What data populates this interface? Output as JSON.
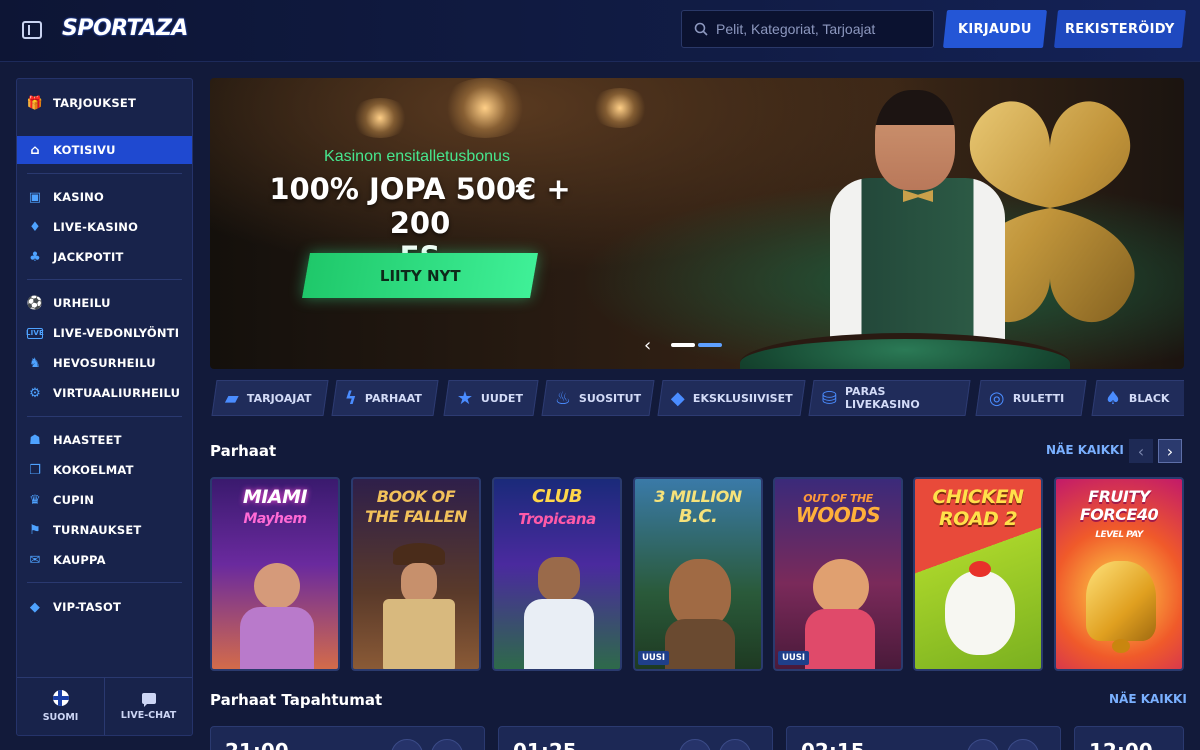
{
  "header": {
    "logo_text": "SPORTAZA",
    "search_placeholder": "Pelit, Kategoriat, Tarjoajat",
    "login_label": "KIRJAUDU",
    "register_label": "REKISTERÖIDY"
  },
  "sidebar": {
    "items": [
      {
        "label": "TARJOUKSET",
        "icon": "gift-icon"
      },
      {
        "label": "KOTISIVU",
        "icon": "home-icon"
      },
      {
        "label": "KASINO",
        "icon": "slot-machine-icon"
      },
      {
        "label": "LIVE-KASINO",
        "icon": "card-icon"
      },
      {
        "label": "JACKPOTIT",
        "icon": "clover-icon"
      },
      {
        "label": "URHEILU",
        "icon": "soccer-ball-icon"
      },
      {
        "label": "LIVE-VEDONLYÖNTI",
        "icon": "live-icon"
      },
      {
        "label": "HEVOSURHEILU",
        "icon": "horse-icon"
      },
      {
        "label": "VIRTUAALIURHEILU",
        "icon": "virtual-sports-icon"
      },
      {
        "label": "HAASTEET",
        "icon": "challenge-icon"
      },
      {
        "label": "KOKOELMAT",
        "icon": "collection-icon"
      },
      {
        "label": "CUPIN",
        "icon": "trophy-icon"
      },
      {
        "label": "TURNAUKSET",
        "icon": "flag-icon"
      },
      {
        "label": "KAUPPA",
        "icon": "shop-icon"
      },
      {
        "label": "VIP-TASOT",
        "icon": "diamond-icon"
      }
    ],
    "active": "KOTISIVU",
    "footer": {
      "language_label": "SUOMI",
      "chat_label": "LIVE-CHAT"
    }
  },
  "hero": {
    "subtitle": "Kasinon ensitalletusbonus",
    "title_line1": "100% JOPA 500€ + 200",
    "title_line2": "FS",
    "cta_label": "LIITY NYT",
    "slides_total": 2,
    "slide_active": 1
  },
  "chips": [
    {
      "label": "TARJOAJAT",
      "icon": "cards-icon"
    },
    {
      "label": "PARHAAT",
      "icon": "lightning-icon"
    },
    {
      "label": "UUDET",
      "icon": "star-icon"
    },
    {
      "label": "SUOSITUT",
      "icon": "flame-icon"
    },
    {
      "label": "EKSKLUSIIVISET",
      "icon": "gem-icon"
    },
    {
      "label": "PARAS LIVEKASINO",
      "icon": "chips-icon"
    },
    {
      "label": "RULETTI",
      "icon": "roulette-icon"
    },
    {
      "label": "BLACK",
      "icon": "blackjack-icon"
    }
  ],
  "games_section": {
    "title": "Parhaat",
    "see_all": "NÄE KAIKKI",
    "games": [
      {
        "title": "MIAMI",
        "subtitle": "Mayhem",
        "badge": ""
      },
      {
        "title": "BOOK OF",
        "subtitle": "THE FALLEN",
        "badge": ""
      },
      {
        "title": "CLUB",
        "subtitle": "Tropicana",
        "badge": ""
      },
      {
        "title": "3 MILLION",
        "subtitle": "B.C.",
        "badge": "UUSI"
      },
      {
        "title": "OUT OF THE",
        "subtitle": "WOODS",
        "badge": "UUSI"
      },
      {
        "title": "CHICKEN",
        "subtitle": "ROAD 2",
        "badge": ""
      },
      {
        "title": "FRUITY",
        "subtitle": "FORCE40",
        "extra": "LEVEL PAY",
        "badge": ""
      }
    ]
  },
  "events_section": {
    "title": "Parhaat Tapahtumat",
    "see_all": "NÄE KAIKKI",
    "events": [
      {
        "time": "21:00"
      },
      {
        "time": "01:25"
      },
      {
        "time": "02:15"
      },
      {
        "time": "12:00"
      }
    ]
  }
}
